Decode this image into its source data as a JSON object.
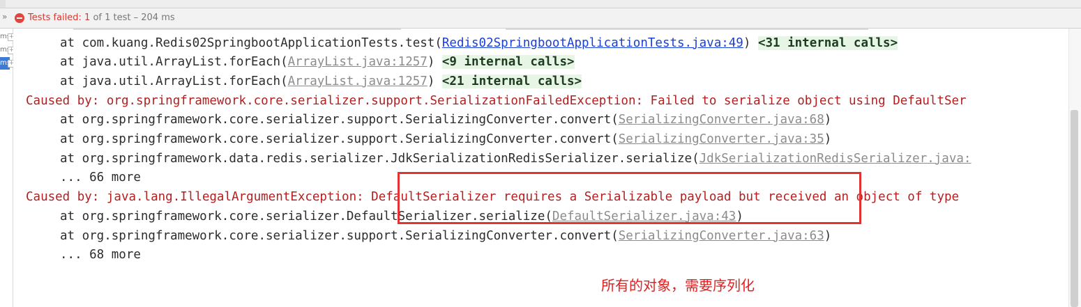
{
  "status_bar": {
    "expand_glyph": "»",
    "label_prefix": "Tests failed: ",
    "failed_count": "1",
    "label_suffix": " of 1 test – 204 ms"
  },
  "test_tree": {
    "rows": [
      {
        "text": "ms",
        "selected": false
      },
      {
        "text": "ms",
        "selected": false
      },
      {
        "text": "ms",
        "selected": true
      }
    ]
  },
  "console": {
    "lines": [
      {
        "kind": "frame",
        "prefix": "at com.kuang.Redis02SpringbootApplicationTests.test(",
        "link": "Redis02SpringbootApplicationTests.java:49",
        "link_style": "blue",
        "suffix": ") ",
        "internal": "<31 internal calls>"
      },
      {
        "kind": "frame",
        "prefix": "at java.util.ArrayList.forEach(",
        "link": "ArrayList.java:1257",
        "link_style": "gray",
        "suffix": ") ",
        "internal": "<9 internal calls>"
      },
      {
        "kind": "frame",
        "prefix": "at java.util.ArrayList.forEach(",
        "link": "ArrayList.java:1257",
        "link_style": "gray",
        "suffix": ") ",
        "internal": "<21 internal calls>"
      },
      {
        "kind": "cause",
        "text": "Caused by: org.springframework.core.serializer.support.SerializationFailedException: Failed to serialize object using DefaultSer"
      },
      {
        "kind": "frame",
        "prefix": "at org.springframework.core.serializer.support.SerializingConverter.convert(",
        "link": "SerializingConverter.java:68",
        "link_style": "gray",
        "suffix": ")",
        "internal": ""
      },
      {
        "kind": "frame",
        "prefix": "at org.springframework.core.serializer.support.SerializingConverter.convert(",
        "link": "SerializingConverter.java:35",
        "link_style": "gray",
        "suffix": ")",
        "internal": ""
      },
      {
        "kind": "frame",
        "prefix": "at org.springframework.data.redis.serializer.JdkSerializationRedisSerializer.serialize(",
        "link": "JdkSerializationRedisSerializer.java:",
        "link_style": "gray",
        "suffix": "",
        "internal": ""
      },
      {
        "kind": "more",
        "text": "... 66 more"
      },
      {
        "kind": "cause",
        "text": "Caused by: java.lang.IllegalArgumentException: DefaultSerializer requires a Serializable payload but received an object of type"
      },
      {
        "kind": "frame",
        "prefix": "at org.springframework.core.serializer.DefaultSerializer.serialize(",
        "link": "DefaultSerializer.java:43",
        "link_style": "gray",
        "suffix": ")",
        "internal": ""
      },
      {
        "kind": "frame",
        "prefix": "at org.springframework.core.serializer.support.SerializingConverter.convert(",
        "link": "SerializingConverter.java:63",
        "link_style": "gray",
        "suffix": ")",
        "internal": ""
      },
      {
        "kind": "more",
        "text": "... 68 more"
      }
    ]
  },
  "annotation": {
    "note": "所有的对象，需要序列化",
    "color": "#e02020"
  },
  "colors": {
    "cause_text": "#b31e1e",
    "frame_text": "#2c2c2c",
    "blue_link": "#1a3fd6",
    "gray_link": "#8c8c8c",
    "internal_bg": "#e7f5e7",
    "fail_icon": "#e0463e"
  }
}
